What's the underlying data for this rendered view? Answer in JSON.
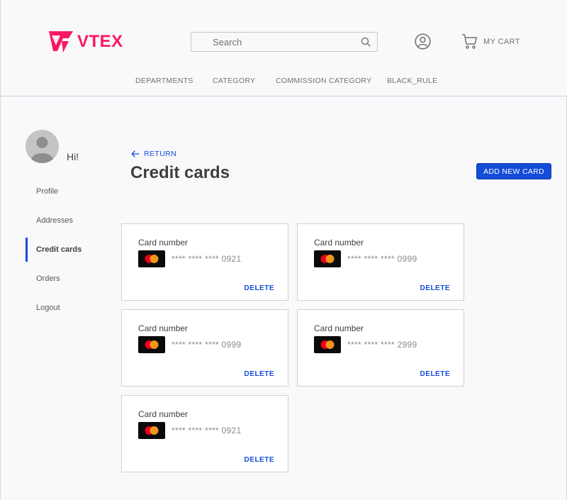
{
  "header": {
    "logo_text": "VTEX",
    "search": {
      "placeholder": "Search",
      "value": ""
    },
    "cart_label": "MY CART",
    "nav": [
      {
        "label": "DEPARTMENTS"
      },
      {
        "label": "CATEGORY"
      },
      {
        "label": "COMMISSION CATEGORY"
      },
      {
        "label": "BLACK_RULE"
      }
    ]
  },
  "sidebar": {
    "greeting": "Hi!",
    "items": [
      {
        "label": "Profile"
      },
      {
        "label": "Addresses"
      },
      {
        "label": "Credit cards",
        "active": true
      },
      {
        "label": "Orders"
      },
      {
        "label": "Logout"
      }
    ]
  },
  "main": {
    "return_label": "RETURN",
    "title": "Credit cards",
    "add_button": "ADD NEW CARD",
    "cards": [
      {
        "title": "Card number",
        "number": "**** **** **** 0921",
        "delete": "DELETE"
      },
      {
        "title": "Card number",
        "number": "**** **** **** 0999",
        "delete": "DELETE"
      },
      {
        "title": "Card number",
        "number": "**** **** **** 0999",
        "delete": "DELETE"
      },
      {
        "title": "Card number",
        "number": "**** **** **** 2999",
        "delete": "DELETE"
      },
      {
        "title": "Card number",
        "number": "**** **** **** 0921",
        "delete": "DELETE"
      }
    ]
  },
  "colors": {
    "brand": "#f71963",
    "accent": "#134cd8",
    "mastercard_red": "#eb001b",
    "mastercard_orange": "#f79e1b"
  },
  "icons": [
    "vtex-logo-icon",
    "search-icon",
    "user-profile-icon",
    "cart-icon",
    "arrow-left-icon",
    "avatar-icon",
    "mastercard-icon"
  ]
}
